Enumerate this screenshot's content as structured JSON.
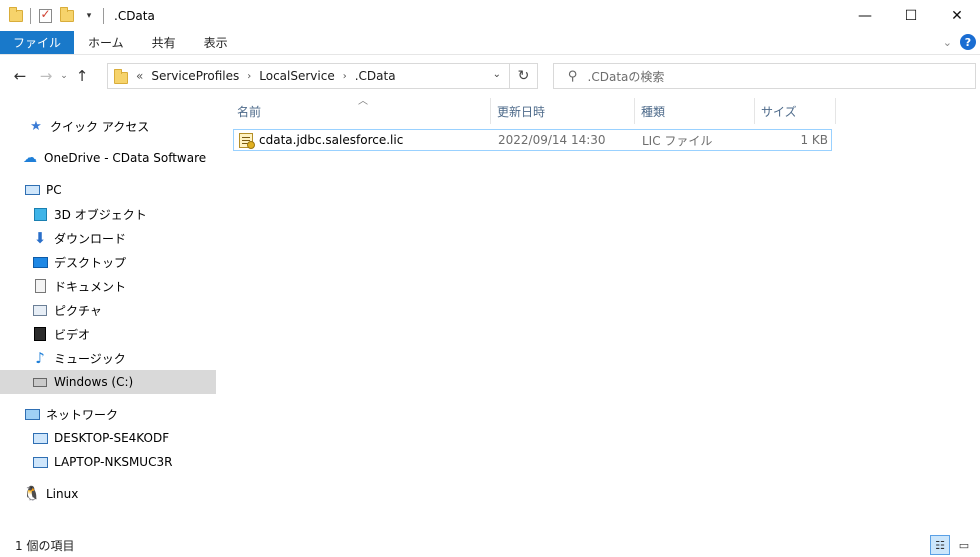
{
  "window": {
    "title": ".CData",
    "controls": {
      "minimize": "—",
      "maximize": "☐",
      "close": "✕"
    }
  },
  "ribbon": {
    "tabs": [
      "ファイル",
      "ホーム",
      "共有",
      "表示"
    ],
    "help": "?"
  },
  "nav": {
    "back": "←",
    "forward": "→",
    "recent": "⌄",
    "up": "↑",
    "breadcrumb": [
      "ServiceProfiles",
      "LocalService",
      ".CData"
    ],
    "overflow": "«",
    "refresh": "↻",
    "search_placeholder": ".CDataの検索"
  },
  "sidebar": {
    "items": [
      {
        "label": "クイック アクセス",
        "icon": "star-icon"
      },
      {
        "label": "OneDrive - CData Software",
        "icon": "cloud-icon"
      },
      {
        "label": "PC",
        "icon": "computer-icon"
      },
      {
        "label": "3D オブジェクト",
        "icon": "cube-icon"
      },
      {
        "label": "ダウンロード",
        "icon": "download-icon"
      },
      {
        "label": "デスクトップ",
        "icon": "desktop-icon"
      },
      {
        "label": "ドキュメント",
        "icon": "document-icon"
      },
      {
        "label": "ピクチャ",
        "icon": "picture-icon"
      },
      {
        "label": "ビデオ",
        "icon": "video-icon"
      },
      {
        "label": "ミュージック",
        "icon": "music-icon"
      },
      {
        "label": "Windows (C:)",
        "icon": "drive-icon"
      },
      {
        "label": "ネットワーク",
        "icon": "network-icon"
      },
      {
        "label": "DESKTOP-SE4KODF",
        "icon": "monitor-icon"
      },
      {
        "label": "LAPTOP-NKSMUC3R",
        "icon": "monitor-icon"
      },
      {
        "label": "Linux",
        "icon": "penguin-icon"
      }
    ]
  },
  "columns": [
    "名前",
    "更新日時",
    "種類",
    "サイズ"
  ],
  "files": [
    {
      "name": "cdata.jdbc.salesforce.lic",
      "modified": "2022/09/14 14:30",
      "type": "LIC ファイル",
      "size": "1 KB"
    }
  ],
  "status": {
    "count": "1 個の項目"
  },
  "colors": {
    "accent": "#1979ca",
    "selection": "#d9d9d9",
    "row_border": "#99d1ff"
  }
}
